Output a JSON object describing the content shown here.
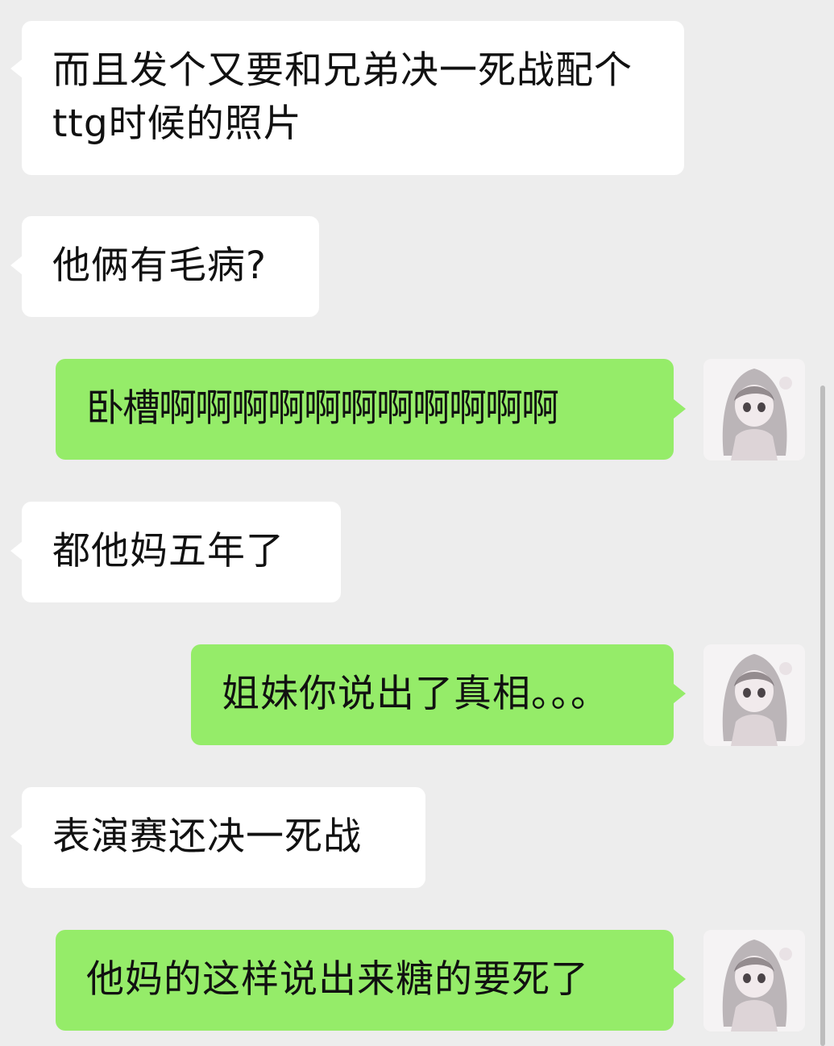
{
  "colors": {
    "background": "#ededed",
    "incoming_bubble": "#ffffff",
    "outgoing_bubble": "#95ec69",
    "text": "#111111"
  },
  "messages": [
    {
      "side": "left",
      "text": "而且发个又要和兄弟决一死战配个ttg时候的照片"
    },
    {
      "side": "left",
      "text": "他俩有毛病?"
    },
    {
      "side": "right",
      "text": "卧槽啊啊啊啊啊啊啊啊啊啊啊"
    },
    {
      "side": "left",
      "text": "都他妈五年了"
    },
    {
      "side": "right",
      "text": "姐妹你说出了真相。。。"
    },
    {
      "side": "left",
      "text": "表演赛还决一死战"
    },
    {
      "side": "right",
      "text": "他妈的这样说出来糖的要死了"
    }
  ],
  "avatar": {
    "icon": "anime-girl-avatar-icon"
  }
}
